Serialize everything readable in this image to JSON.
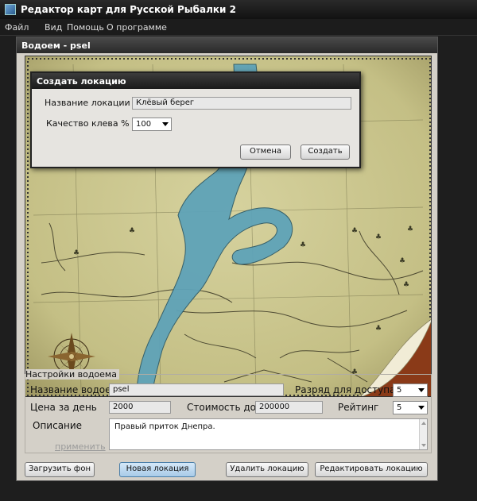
{
  "app": {
    "title": "Редактор карт для Русской Рыбалки 2"
  },
  "menu": [
    "Файл",
    "Вид",
    "Помощь",
    "О программе"
  ],
  "window": {
    "title": "Водоем - psel"
  },
  "dialog": {
    "title": "Создать локацию",
    "name_label": "Название локации",
    "name_value": "Клёвый берег",
    "quality_label": "Качество клева %",
    "quality_value": "100",
    "cancel_label": "Отмена",
    "create_label": "Создать"
  },
  "settings": {
    "group_title": "Настройки водоема",
    "name_label": "Название водоема",
    "name_value": "psel",
    "access_label": "Разряд для доступа",
    "access_value": "5",
    "price_label": "Цена за день",
    "price_value": "2000",
    "house_label": "Стоимость дома",
    "house_value": "200000",
    "rating_label": "Рейтинг",
    "rating_value": "5",
    "desc_label": "Описание",
    "desc_value": "Правый приток Днепра.",
    "apply_label": "применить"
  },
  "buttons": {
    "load_bg": "Загрузить фон",
    "new_location": "Новая локация",
    "delete_location": "Удалить локацию",
    "edit_location": "Редактировать локацию"
  },
  "colors": {
    "water": "#5fa3b8",
    "parchment": "#c9c48e",
    "accent": "#a8cbe8"
  }
}
